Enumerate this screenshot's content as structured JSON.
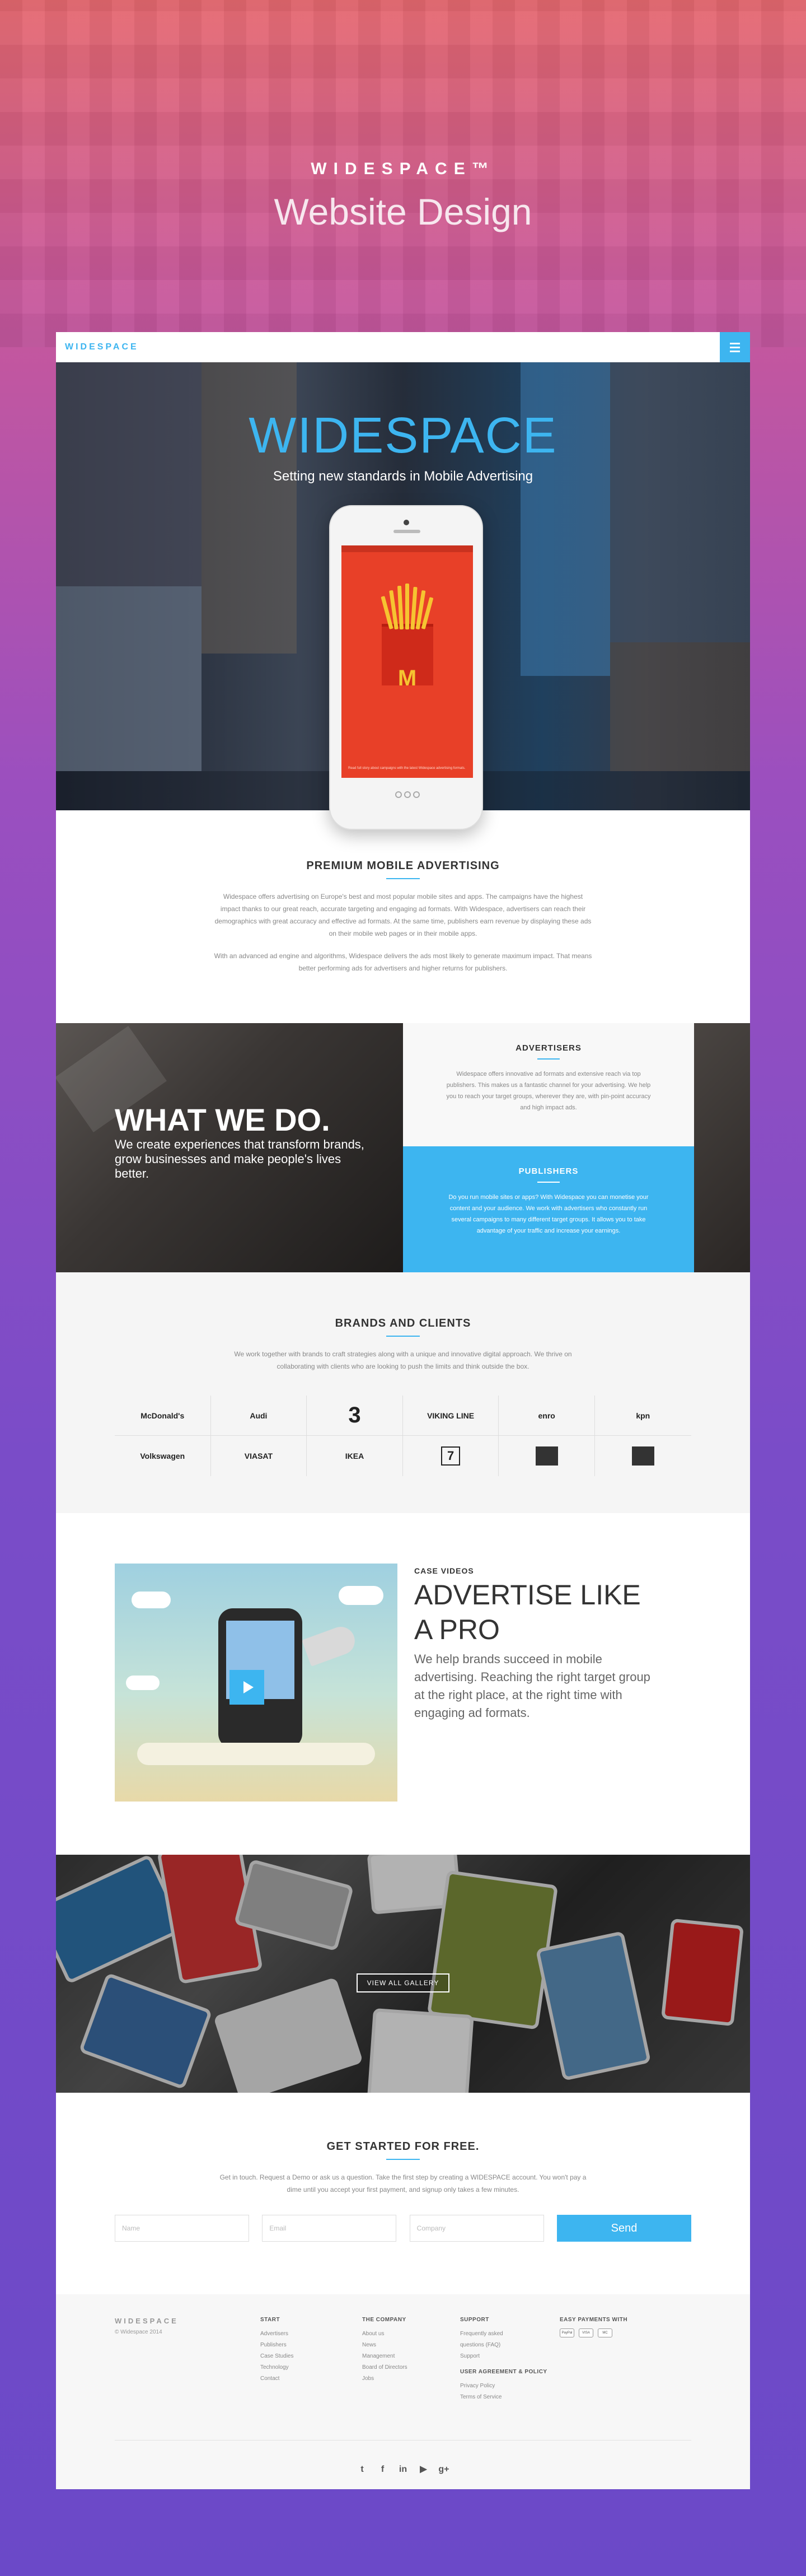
{
  "presentation": {
    "logo": "WIDESPACE™",
    "title": "Website Design"
  },
  "nav": {
    "logo": "WIDESPACE",
    "menu_icon": "hamburger-icon"
  },
  "banner": {
    "title": "WIDESPACE",
    "subtitle": "Setting new standards in Mobile Advertising",
    "phone_caption": "Read full story about campaigns with the latest Widespace advertising formats."
  },
  "premium": {
    "title": "PREMIUM MOBILE ADVERTISING",
    "p1": "Widespace offers advertising on Europe's best and most popular mobile sites and apps. The campaigns have the highest impact thanks to our great reach, accurate targeting and engaging ad formats. With Widespace, advertisers can reach their demographics with great accuracy and effective ad formats. At the same time, publishers earn revenue by displaying these ads on their mobile web pages or in their mobile apps.",
    "p2": "With an advanced ad engine and algorithms, Widespace delivers the ads most likely to generate maximum impact. That means better performing ads for advertisers and higher returns for publishers."
  },
  "what_we_do": {
    "heading": "WHAT WE DO.",
    "text": "We create experiences that transform brands, grow businesses and make people's lives better.",
    "advertisers_title": "ADVERTISERS",
    "advertisers_text": "Widespace offers innovative ad formats and extensive reach via top publishers. This makes us a fantastic channel for your advertising. We help you to reach your target groups, wherever they are, with pin-point accuracy and high impact ads.",
    "publishers_title": "PUBLISHERS",
    "publishers_text": "Do you run mobile sites or apps? With Widespace you can monetise your content and your audience. We work with advertisers who constantly run several campaigns to many different target groups. It allows you to take advantage of your traffic and increase your earnings."
  },
  "brands": {
    "title": "BRANDS AND CLIENTS",
    "text": "We work together with brands to craft strategies along with a unique and innovative digital approach. We thrive on collaborating with clients who are looking to push the limits and think outside the box.",
    "row1": [
      "McDonald's",
      "Audi",
      "3",
      "VIKING LINE",
      "enro",
      "kpn"
    ],
    "row2": [
      "Volkswagen",
      "VIASAT",
      "IKEA",
      "7",
      "",
      ""
    ]
  },
  "cases": {
    "kicker": "CASE VIDEOS",
    "title": "ADVERTISE LIKE A PRO",
    "text": "We help brands succeed in mobile advertising. Reaching the right target group at the right place, at the right time with engaging ad formats."
  },
  "gallery": {
    "button": "VIEW ALL GALLERY"
  },
  "get_started": {
    "title": "GET STARTED FOR FREE.",
    "text": "Get in touch. Request a Demo or ask us a question. Take the first step by creating a WIDESPACE account. You won't pay a dime until you accept your first payment, and signup only takes a few minutes.",
    "name_placeholder": "Name",
    "email_placeholder": "Email",
    "company_placeholder": "Company",
    "send": "Send"
  },
  "footer": {
    "logo": "WIDESPACE",
    "copyright": "© Widespace 2014",
    "start_title": "START",
    "start_links": [
      "Advertisers",
      "Publishers",
      "Case Studies",
      "Technology",
      "Contact"
    ],
    "company_title": "THE COMPANY",
    "company_links": [
      "About us",
      "News",
      "Management",
      "Board of Directors",
      "Jobs"
    ],
    "support_title": "SUPPORT",
    "support_links": [
      "Frequently asked questions (FAQ)",
      "Support"
    ],
    "agreement_title": "USER AGREEMENT & POLICY",
    "agreement_links": [
      "Privacy Policy",
      "Terms of Service"
    ],
    "payments_title": "EASY PAYMENTS WITH",
    "payments": [
      "PayPal",
      "VISA",
      "MC"
    ],
    "social": [
      "t",
      "f",
      "in",
      "▶",
      "g+"
    ]
  }
}
